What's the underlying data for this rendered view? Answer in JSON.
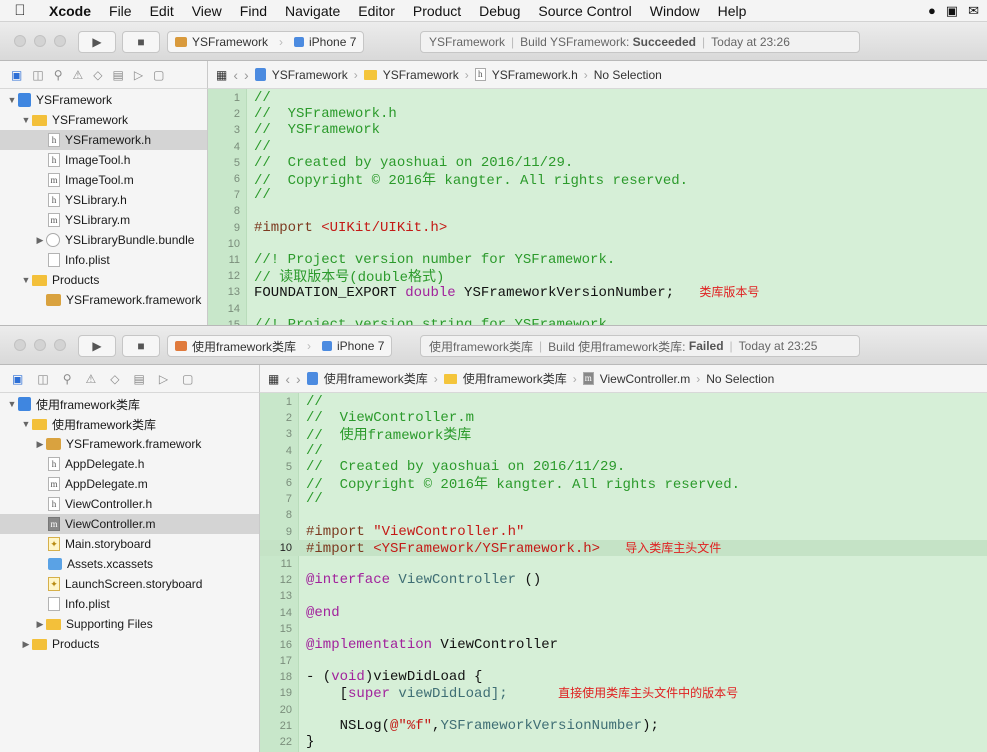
{
  "menubar": {
    "apple": "",
    "items": [
      "Xcode",
      "File",
      "Edit",
      "View",
      "Find",
      "Navigate",
      "Editor",
      "Product",
      "Debug",
      "Source Control",
      "Window",
      "Help"
    ]
  },
  "window1": {
    "scheme_name": "YSFramework",
    "device": "iPhone 7",
    "status": {
      "project": "YSFramework",
      "build_label": "Build YSFramework:",
      "build_result": "Succeeded",
      "time": "Today at 23:26"
    },
    "jumpbar": [
      "YSFramework",
      "YSFramework",
      "YSFramework.h",
      "No Selection"
    ],
    "navigator": [
      {
        "label": "YSFramework",
        "icon": "project"
      },
      {
        "label": "YSFramework",
        "icon": "folder"
      },
      {
        "label": "YSFramework.h",
        "icon": "h"
      },
      {
        "label": "ImageTool.h",
        "icon": "h"
      },
      {
        "label": "ImageTool.m",
        "icon": "m"
      },
      {
        "label": "YSLibrary.h",
        "icon": "h"
      },
      {
        "label": "YSLibrary.m",
        "icon": "m"
      },
      {
        "label": "YSLibraryBundle.bundle",
        "icon": "bundle"
      },
      {
        "label": "Info.plist",
        "icon": "plist"
      },
      {
        "label": "Products",
        "icon": "folder"
      },
      {
        "label": "YSFramework.framework",
        "icon": "framework"
      }
    ],
    "code": [
      {
        "n": "1",
        "t": "//"
      },
      {
        "n": "2",
        "t": "//  YSFramework.h"
      },
      {
        "n": "3",
        "t": "//  YSFramework"
      },
      {
        "n": "4",
        "t": "//"
      },
      {
        "n": "5",
        "t": "//  Created by yaoshuai on 2016/11/29."
      },
      {
        "n": "6",
        "t": "//  Copyright © 2016年 kangter. All rights reserved."
      },
      {
        "n": "7",
        "t": "//"
      },
      {
        "n": "8",
        "t": ""
      },
      {
        "n": "9",
        "a": "#import ",
        "b": "<UIKit/UIKit.h>"
      },
      {
        "n": "10",
        "t": ""
      },
      {
        "n": "11",
        "t": "//! Project version number for YSFramework."
      },
      {
        "n": "12",
        "t": "// 读取版本号(double格式)"
      },
      {
        "n": "13",
        "a": "FOUNDATION_EXPORT ",
        "k": "double",
        "b": " YSFrameworkVersionNumber;"
      },
      {
        "n": "14",
        "t": ""
      },
      {
        "n": "15",
        "t": "//! Project version string for YSFramework."
      }
    ],
    "note_line13": "类库版本号"
  },
  "window2": {
    "scheme_name": "使用framework类库",
    "device": "iPhone 7",
    "status": {
      "project": "使用framework类库",
      "build_label": "Build 使用framework类库:",
      "build_result": "Failed",
      "time": "Today at 23:25"
    },
    "jumpbar": [
      "使用framework类库",
      "使用framework类库",
      "ViewController.m",
      "No Selection"
    ],
    "navigator": [
      {
        "label": "使用framework类库",
        "icon": "project"
      },
      {
        "label": "使用framework类库",
        "icon": "folder"
      },
      {
        "label": "YSFramework.framework",
        "icon": "framework"
      },
      {
        "label": "AppDelegate.h",
        "icon": "h"
      },
      {
        "label": "AppDelegate.m",
        "icon": "m"
      },
      {
        "label": "ViewController.h",
        "icon": "h"
      },
      {
        "label": "ViewController.m",
        "icon": "m"
      },
      {
        "label": "Main.storyboard",
        "icon": "storyboard"
      },
      {
        "label": "Assets.xcassets",
        "icon": "xcassets"
      },
      {
        "label": "LaunchScreen.storyboard",
        "icon": "storyboard"
      },
      {
        "label": "Info.plist",
        "icon": "plist"
      },
      {
        "label": "Supporting Files",
        "icon": "folder"
      },
      {
        "label": "Products",
        "icon": "folder"
      }
    ],
    "code_lines": [
      "1",
      "2",
      "3",
      "4",
      "5",
      "6",
      "7",
      "8",
      "9",
      "10",
      "11",
      "12",
      "13",
      "14",
      "15",
      "16",
      "17",
      "18",
      "19",
      "20",
      "21",
      "22"
    ],
    "code_text": {
      "l1": "//",
      "l2": "//  ViewController.m",
      "l3": "//  使用framework类库",
      "l4": "//",
      "l5": "//  Created by yaoshuai on 2016/11/29.",
      "l6": "//  Copyright © 2016年 kangter. All rights reserved.",
      "l7": "//",
      "l9_a": "#import ",
      "l9_b": "\"ViewController.h\"",
      "l10_a": "#import ",
      "l10_b": "<YSFramework/YSFramework.h>",
      "l12_a": "@interface ",
      "l12_b": "ViewController",
      "l12_c": " ()",
      "l14": "@end",
      "l16_a": "@implementation ",
      "l16_b": "ViewController",
      "l18_a": "- (",
      "l18_b": "void",
      "l18_c": ")viewDidLoad {",
      "l19_a": "    [",
      "l19_b": "super",
      "l19_c": " viewDidLoad];",
      "l21_a": "    NSLog(",
      "l21_b": "@\"%f\"",
      "l21_c": ",",
      "l21_d": "YSFrameworkVersionNumber",
      "l21_e": ");",
      "l22": "}"
    },
    "note_line10": "导入类库主头文件",
    "note_line19": "直接使用类库主头文件中的版本号"
  }
}
